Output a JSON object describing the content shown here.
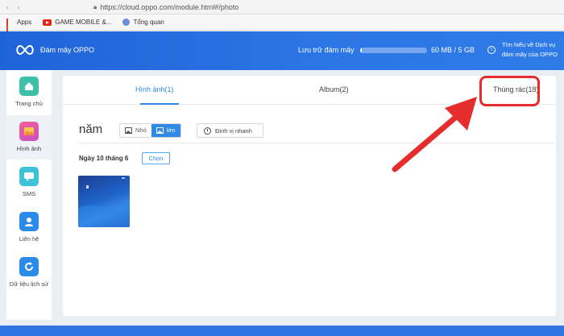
{
  "browser": {
    "url": "https://cloud.oppo.com/module.html#/photo",
    "bookmarks": [
      {
        "label": "Apps",
        "icon": "apps-grid-icon"
      },
      {
        "label": "GAME MOBILE &...",
        "icon": "youtube-icon"
      },
      {
        "label": "Tổng quan",
        "icon": "bookmark-site-icon"
      }
    ]
  },
  "header": {
    "brand": "Đám mây OPPO",
    "storage_label": "Lưu trữ đám mây",
    "storage_value": "60 MB / 5 GB",
    "storage_used_fraction": 0.012,
    "info_line1": "Tìm hiểu về Dịch vụ",
    "info_line2": "đám mây của OPPO",
    "accent": "#2b75e6"
  },
  "sidebar": {
    "items": [
      {
        "label": "Trang chủ",
        "icon": "home-icon",
        "color": "#3dbfa8"
      },
      {
        "label": "Hình ảnh",
        "icon": "photo-icon",
        "color": "#e05aa8"
      },
      {
        "label": "SMS",
        "icon": "sms-icon",
        "color": "#3fc1d9"
      },
      {
        "label": "Liên hệ",
        "icon": "contact-icon",
        "color": "#2b8be8"
      },
      {
        "label": "Dữ liệu lịch sử",
        "icon": "refresh-icon",
        "color": "#2b8be8"
      }
    ]
  },
  "tabs": [
    {
      "label": "Hình ảnh(1)",
      "active": true
    },
    {
      "label": "Album(2)",
      "active": false
    },
    {
      "label": "Thùng rác(18)",
      "active": false
    }
  ],
  "toolbar": {
    "year": "năm",
    "small": "Nhỏ",
    "large": "lớn",
    "locate": "Định vị nhanh"
  },
  "group": {
    "date": "Ngày 10 tháng 6",
    "choose": "Chọn"
  },
  "annotation_color": "#e52d2d"
}
